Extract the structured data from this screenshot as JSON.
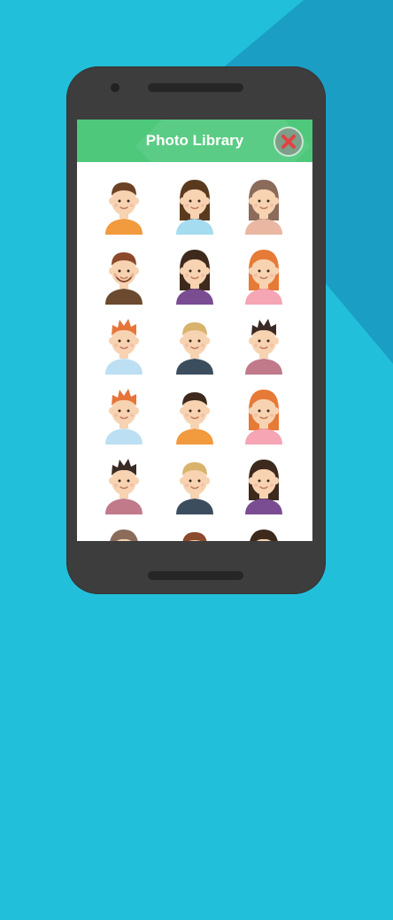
{
  "header": {
    "title": "Photo Library",
    "close_icon": "close-icon"
  },
  "avatars": [
    {
      "id": "avatar-1",
      "gender": "male",
      "hair": "#6b4226",
      "shirt": "#f19a3e",
      "style": "short"
    },
    {
      "id": "avatar-2",
      "gender": "female",
      "hair": "#5a3a1f",
      "shirt": "#a6dcef",
      "style": "long"
    },
    {
      "id": "avatar-3",
      "gender": "female",
      "hair": "#8b6b5a",
      "shirt": "#e9b7a2",
      "style": "long"
    },
    {
      "id": "avatar-4",
      "gender": "male",
      "hair": "#8b4a2b",
      "shirt": "#6b4a2f",
      "style": "beard"
    },
    {
      "id": "avatar-5",
      "gender": "female",
      "hair": "#3e2a1d",
      "shirt": "#7a4d92",
      "style": "long"
    },
    {
      "id": "avatar-6",
      "gender": "female",
      "hair": "#e67a37",
      "shirt": "#f5a5b4",
      "style": "long"
    },
    {
      "id": "avatar-7",
      "gender": "male",
      "hair": "#e6753a",
      "shirt": "#bcdff4",
      "style": "spiky"
    },
    {
      "id": "avatar-8",
      "gender": "male",
      "hair": "#d8b36b",
      "shirt": "#3c4d5e",
      "style": "short"
    },
    {
      "id": "avatar-9",
      "gender": "male",
      "hair": "#3a2a25",
      "shirt": "#c07a8a",
      "style": "spiky"
    },
    {
      "id": "avatar-10",
      "gender": "male",
      "hair": "#e6753a",
      "shirt": "#bcdff4",
      "style": "spiky"
    },
    {
      "id": "avatar-11",
      "gender": "male",
      "hair": "#3e2a1d",
      "shirt": "#f19a3e",
      "style": "short"
    },
    {
      "id": "avatar-12",
      "gender": "female",
      "hair": "#e67a37",
      "shirt": "#f5a5b4",
      "style": "long"
    },
    {
      "id": "avatar-13",
      "gender": "male",
      "hair": "#3a2a25",
      "shirt": "#c07a8a",
      "style": "spiky"
    },
    {
      "id": "avatar-14",
      "gender": "male",
      "hair": "#d8b36b",
      "shirt": "#3c4d5e",
      "style": "short"
    },
    {
      "id": "avatar-15",
      "gender": "female",
      "hair": "#3e2a1d",
      "shirt": "#7a4d92",
      "style": "long"
    },
    {
      "id": "avatar-16",
      "gender": "female",
      "hair": "#8b6b5a",
      "shirt": "#e9b7a2",
      "style": "long"
    },
    {
      "id": "avatar-17",
      "gender": "male",
      "hair": "#8b4a2b",
      "shirt": "#6b4a2f",
      "style": "short"
    },
    {
      "id": "avatar-18",
      "gender": "female",
      "hair": "#3e2a1d",
      "shirt": "#7a4d92",
      "style": "long"
    }
  ],
  "colors": {
    "background": "#22bfdb",
    "header": "#4ec87b",
    "phone": "#3d3d3d",
    "close_x": "#e2433f"
  }
}
